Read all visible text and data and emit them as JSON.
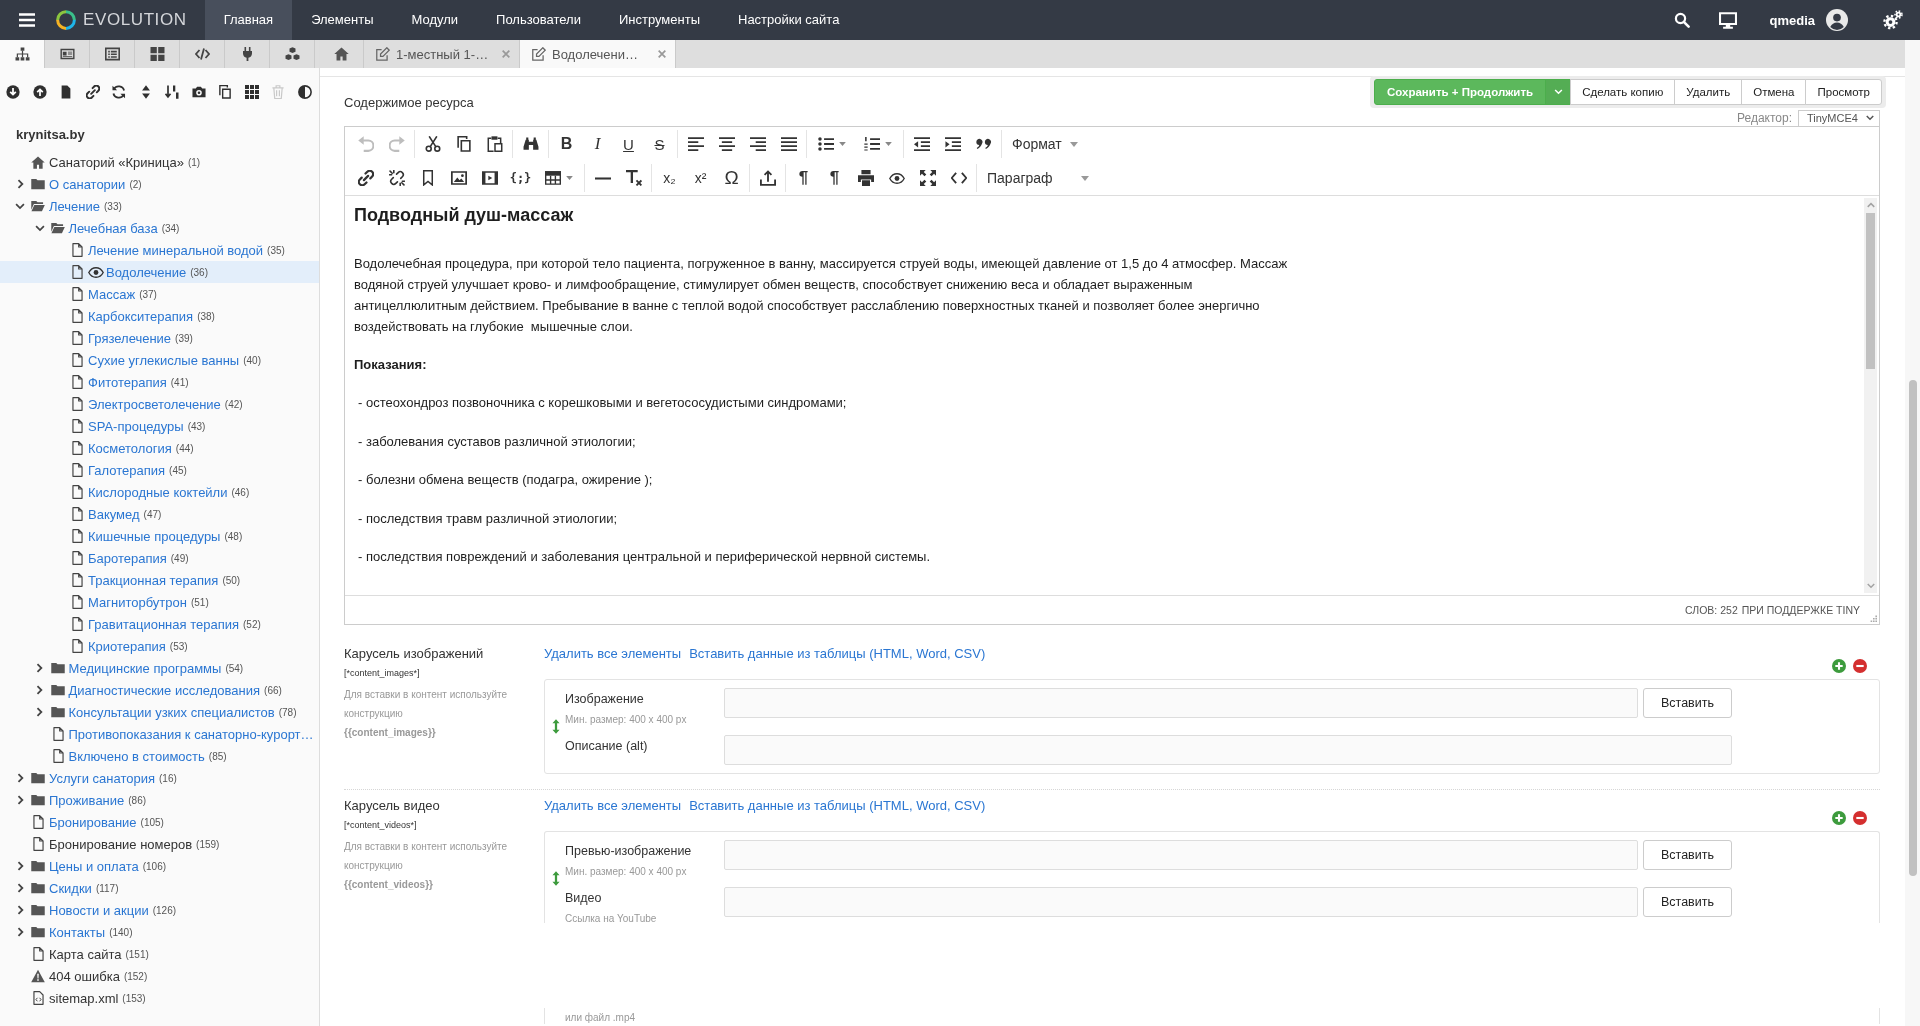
{
  "topbar": {
    "brand": "EVOLUTION",
    "menu": [
      {
        "label": "Главная",
        "selected": true
      },
      {
        "label": "Элементы",
        "selected": false
      },
      {
        "label": "Модули",
        "selected": false
      },
      {
        "label": "Пользователи",
        "selected": false
      },
      {
        "label": "Инструменты",
        "selected": false
      },
      {
        "label": "Настройки сайта",
        "selected": false
      }
    ],
    "user": "qmedia"
  },
  "sidebar_tabs": [
    {
      "kind": "sitemap",
      "selected": true
    },
    {
      "kind": "card",
      "selected": false
    },
    {
      "kind": "list",
      "selected": false
    },
    {
      "kind": "tiles",
      "selected": false
    },
    {
      "kind": "code",
      "selected": false
    },
    {
      "kind": "plug",
      "selected": false
    },
    {
      "kind": "cubes",
      "selected": false
    }
  ],
  "doc_tabs": [
    {
      "kind": "home",
      "selected": false
    },
    {
      "kind": "document",
      "label": "1-местный 1-…",
      "selected": false
    },
    {
      "kind": "document",
      "label": "Водолечени…",
      "selected": true
    }
  ],
  "actions": [
    {
      "kind": "split",
      "label": "Сохранить + Продолжить"
    },
    {
      "kind": "plain",
      "label": "Сделать копию"
    },
    {
      "kind": "plain",
      "label": "Удалить"
    },
    {
      "kind": "plain",
      "label": "Отмена"
    },
    {
      "kind": "plain",
      "label": "Просмотр"
    }
  ],
  "tree_toolbar": [
    {
      "kind": "expand",
      "disabled": false
    },
    {
      "kind": "collapse",
      "disabled": false
    },
    {
      "kind": "newpage",
      "disabled": false
    },
    {
      "kind": "weblink",
      "disabled": false
    },
    {
      "kind": "refresh",
      "disabled": false
    },
    {
      "kind": "sort",
      "disabled": false
    },
    {
      "kind": "order",
      "disabled": false
    },
    {
      "kind": "snapshot",
      "disabled": false
    },
    {
      "kind": "copy",
      "disabled": false
    },
    {
      "kind": "grid",
      "disabled": false
    },
    {
      "kind": "trash",
      "disabled": true
    },
    {
      "kind": "theme",
      "disabled": false
    }
  ],
  "tree": {
    "root": "krynitsa.by",
    "items": [
      {
        "title": "Санаторий «Криница»",
        "number": "(1)",
        "kind": "home",
        "in_menu": false,
        "selected": false
      },
      {
        "title": "О санатории",
        "number": "(2)",
        "kind": "folder",
        "in_menu": true,
        "selected": false,
        "expanded": false
      },
      {
        "title": "Лечение",
        "number": "(33)",
        "kind": "folder",
        "in_menu": true,
        "selected": false,
        "expanded": true,
        "children": [
          {
            "title": "Лечебная база",
            "number": "(34)",
            "kind": "folder",
            "in_menu": true,
            "selected": false,
            "expanded": true,
            "children": [
              {
                "title": "Лечение минеральной водой",
                "number": "(35)",
                "kind": "page",
                "in_menu": true,
                "selected": false
              },
              {
                "title": "Водолечение",
                "number": "(36)",
                "kind": "page",
                "in_menu": true,
                "selected": true
              },
              {
                "title": "Массаж",
                "number": "(37)",
                "kind": "page",
                "in_menu": true,
                "selected": false
              },
              {
                "title": "Карбокситерапия",
                "number": "(38)",
                "kind": "page",
                "in_menu": true,
                "selected": false
              },
              {
                "title": "Грязелечение",
                "number": "(39)",
                "kind": "page",
                "in_menu": true,
                "selected": false
              },
              {
                "title": "Сухие углекислые ванны",
                "number": "(40)",
                "kind": "page",
                "in_menu": true,
                "selected": false
              },
              {
                "title": "Фитотерапия",
                "number": "(41)",
                "kind": "page",
                "in_menu": true,
                "selected": false
              },
              {
                "title": "Электросветолечение",
                "number": "(42)",
                "kind": "page",
                "in_menu": true,
                "selected": false
              },
              {
                "title": "SPA-процедуры",
                "number": "(43)",
                "kind": "page",
                "in_menu": true,
                "selected": false
              },
              {
                "title": "Косметология",
                "number": "(44)",
                "kind": "page",
                "in_menu": true,
                "selected": false
              },
              {
                "title": "Галотерапия",
                "number": "(45)",
                "kind": "page",
                "in_menu": true,
                "selected": false
              },
              {
                "title": "Кислородные коктейли",
                "number": "(46)",
                "kind": "page",
                "in_menu": true,
                "selected": false
              },
              {
                "title": "Вакумед",
                "number": "(47)",
                "kind": "page",
                "in_menu": true,
                "selected": false
              },
              {
                "title": "Кишечные процедуры",
                "number": "(48)",
                "kind": "page",
                "in_menu": true,
                "selected": false
              },
              {
                "title": "Баротерапия",
                "number": "(49)",
                "kind": "page",
                "in_menu": true,
                "selected": false
              },
              {
                "title": "Тракционная терапия",
                "number": "(50)",
                "kind": "page",
                "in_menu": true,
                "selected": false
              },
              {
                "title": "Магниторбутрон",
                "number": "(51)",
                "kind": "page",
                "in_menu": true,
                "selected": false
              },
              {
                "title": "Гравитационная терапия",
                "number": "(52)",
                "kind": "page",
                "in_menu": true,
                "selected": false
              },
              {
                "title": "Криотерапия",
                "number": "(53)",
                "kind": "page",
                "in_menu": true,
                "selected": false
              }
            ]
          },
          {
            "title": "Медицинские программы",
            "number": "(54)",
            "kind": "folder",
            "in_menu": true,
            "selected": false,
            "expanded": false
          },
          {
            "title": "Диагностические исследования",
            "number": "(66)",
            "kind": "folder",
            "in_menu": true,
            "selected": false,
            "expanded": false
          },
          {
            "title": "Консультации узких специалистов",
            "number": "(78)",
            "kind": "folder",
            "in_menu": true,
            "selected": false,
            "expanded": false
          },
          {
            "title": "Противопоказания к санаторно-курорт…",
            "kind": "page",
            "in_menu": true,
            "selected": false
          },
          {
            "title": "Включено в стоимость",
            "number": "(85)",
            "kind": "page",
            "in_menu": true,
            "selected": false
          }
        ]
      },
      {
        "title": "Услуги санатория",
        "number": "(16)",
        "kind": "folder",
        "in_menu": true,
        "selected": false,
        "expanded": false
      },
      {
        "title": "Проживание",
        "number": "(86)",
        "kind": "folder",
        "in_menu": true,
        "selected": false,
        "expanded": false
      },
      {
        "title": "Бронирование",
        "number": "(105)",
        "kind": "page",
        "in_menu": true,
        "selected": false
      },
      {
        "title": "Бронирование номеров",
        "number": "(159)",
        "kind": "page",
        "in_menu": false,
        "selected": false
      },
      {
        "title": "Цены и оплата",
        "number": "(106)",
        "kind": "folder",
        "in_menu": true,
        "selected": false,
        "expanded": false
      },
      {
        "title": "Скидки",
        "number": "(117)",
        "kind": "folder",
        "in_menu": true,
        "selected": false,
        "expanded": false
      },
      {
        "title": "Новости и акции",
        "number": "(126)",
        "kind": "folder",
        "in_menu": true,
        "selected": false,
        "expanded": false
      },
      {
        "title": "Контакты",
        "number": "(140)",
        "kind": "folder",
        "in_menu": true,
        "selected": false,
        "expanded": false
      },
      {
        "title": "Карта сайта",
        "number": "(151)",
        "kind": "page",
        "in_menu": false,
        "selected": false
      },
      {
        "title": "404 ошибка",
        "number": "(152)",
        "kind": "error",
        "in_menu": false,
        "selected": false
      },
      {
        "title": "sitemap.xml",
        "number": "(153)",
        "kind": "xml",
        "in_menu": false,
        "selected": false
      }
    ]
  },
  "document": {
    "content_label": "Содержимое ресурса",
    "editor_label": "Редактор:",
    "editor_value": "TinyMCE4"
  },
  "editor": {
    "toolbar": [
      [
        [
          {
            "kind": "undo",
            "disabled": true
          },
          {
            "kind": "redo",
            "disabled": true
          }
        ],
        [
          {
            "kind": "cut",
            "disabled": false
          },
          {
            "kind": "copy",
            "disabled": false
          },
          {
            "kind": "paste",
            "disabled": false
          }
        ],
        [
          {
            "kind": "find",
            "disabled": false
          }
        ],
        [
          {
            "kind": "bold",
            "label": "B",
            "disabled": false
          },
          {
            "kind": "italic",
            "label": "I",
            "disabled": false
          },
          {
            "kind": "underline",
            "label": "U",
            "disabled": false
          },
          {
            "kind": "strike",
            "label": "S",
            "disabled": false
          }
        ],
        [
          {
            "kind": "alignleft",
            "disabled": false
          },
          {
            "kind": "aligncenter",
            "disabled": false
          },
          {
            "kind": "alignright",
            "disabled": false
          },
          {
            "kind": "justify",
            "disabled": false
          }
        ],
        [
          {
            "kind": "bullist",
            "disabled": false
          },
          {
            "kind": "numlist",
            "disabled": false
          }
        ],
        [
          {
            "kind": "outdent",
            "disabled": false
          },
          {
            "kind": "indent",
            "disabled": false
          },
          {
            "kind": "blockquote",
            "disabled": false
          }
        ],
        [
          {
            "kind": "format",
            "label": "Формат",
            "disabled": false
          }
        ]
      ],
      [
        [
          {
            "kind": "link",
            "disabled": false
          },
          {
            "kind": "unlink",
            "disabled": false
          },
          {
            "kind": "anchor",
            "disabled": false
          },
          {
            "kind": "image",
            "disabled": false
          },
          {
            "kind": "media",
            "disabled": false
          },
          {
            "kind": "codesample",
            "label": "{;}",
            "disabled": false
          },
          {
            "kind": "table",
            "disabled": false
          }
        ],
        [
          {
            "kind": "hr",
            "disabled": false
          },
          {
            "kind": "removeformat",
            "disabled": false
          }
        ],
        [
          {
            "kind": "subscript",
            "label": "x₂",
            "disabled": false
          },
          {
            "kind": "superscript",
            "label": "x²",
            "disabled": false
          },
          {
            "kind": "charmap",
            "label": "Ω",
            "disabled": false
          }
        ],
        [
          {
            "kind": "template",
            "disabled": false
          }
        ],
        [
          {
            "kind": "ltr",
            "label": "¶",
            "disabled": false
          },
          {
            "kind": "rtl",
            "label": "¶",
            "disabled": false
          },
          {
            "kind": "print",
            "disabled": false
          },
          {
            "kind": "preview",
            "disabled": false
          },
          {
            "kind": "fullscreen",
            "disabled": false
          },
          {
            "kind": "source",
            "disabled": false
          }
        ],
        [
          {
            "kind": "block",
            "label": "Параграф",
            "disabled": false
          }
        ]
      ]
    ],
    "heading": "Подводный душ-массаж",
    "paragraph": "Водолечебная процедура, при которой тело пациента, погруженное в ванну, массируется струей воды, имеющей давление от 1,5 до 4 атмосфер. Массаж водяной струей улучшает крово- и лимфообращение, стимулирует обмен веществ, способствует снижению веса и обладает выраженным антицеллюлитным действием. Пребывание в ванне с теплой водой способствует расслаблению поверхностных тканей и позволяет более энергично воздействовать на глубокие  мышечные слои.",
    "subheading": "Показания:",
    "items": [
      "- остеохондроз позвоночника с корешковыми и вегетососудистыми синдромами;",
      "- заболевания суставов различной этиологии;",
      "- болезни обмена веществ (подагра, ожирение );",
      "- последствия травм различной этиологии;",
      "- последствия повреждений и заболевания центральной и периферической нервной системы."
    ],
    "word_count": "СЛОВ: 252",
    "branding": "ПРИ ПОДДЕРЖКЕ TINY"
  },
  "carousels": [
    {
      "title": "Карусель изображений",
      "tag": "[*content_images*]",
      "hint": "Для вставки в контент используйте конструкцию",
      "snippet": "{{content_images}}",
      "links": [
        "Удалить все элементы",
        "Вставить данные из таблицы (HTML, Word, CSV)"
      ],
      "fields": [
        {
          "label": "Изображение",
          "hint": "Мин. размер: 400 x 400 px",
          "button": "Вставить"
        },
        {
          "label": "Описание (alt)"
        }
      ]
    },
    {
      "title": "Карусель видео",
      "tag": "[*content_videos*]",
      "hint": "Для вставки в контент используйте конструкцию",
      "snippet": "{{content_videos}}",
      "links": [
        "Удалить все элементы",
        "Вставить данные из таблицы (HTML, Word, CSV)"
      ],
      "fields": [
        {
          "label": "Превью-изображение",
          "hint": "Мин. размер: 400 x 400 px",
          "button": "Вставить"
        },
        {
          "label": "Видео",
          "hint": "Ссылка на YouTube",
          "button": "Вставить"
        }
      ],
      "trailing_hint": "или файл .mp4"
    }
  ]
}
